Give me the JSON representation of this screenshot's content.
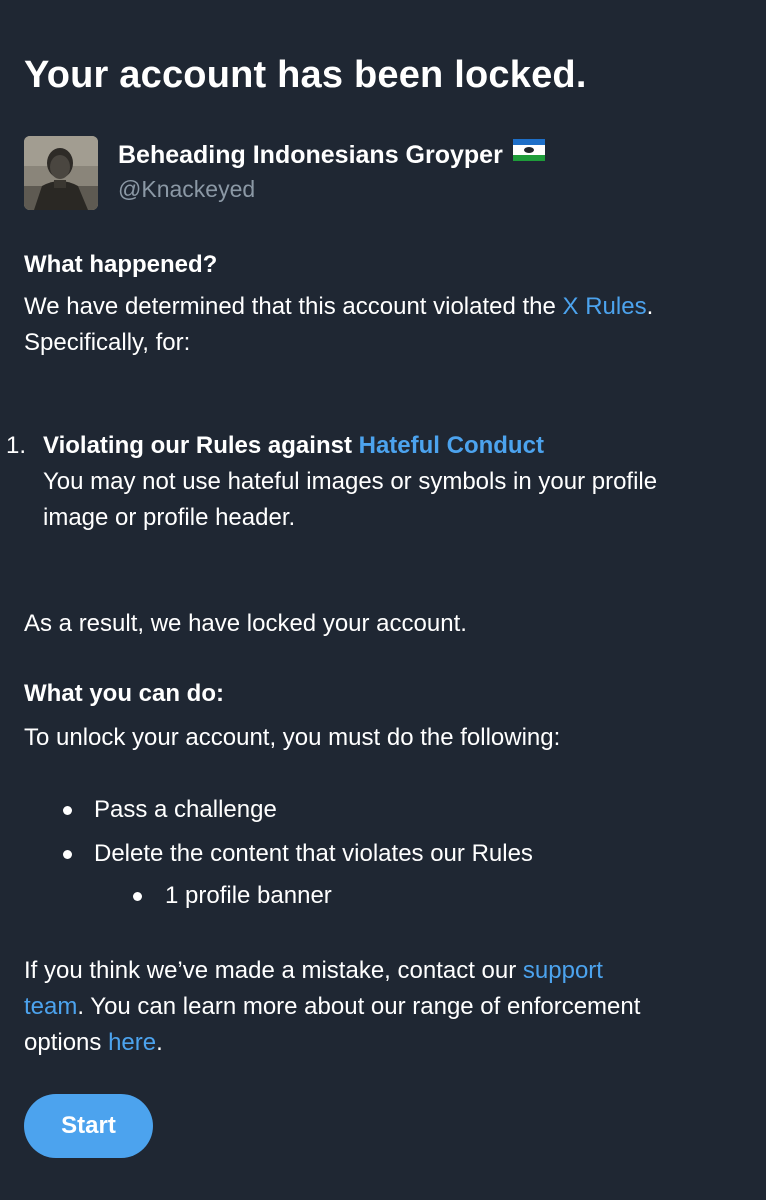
{
  "header": {
    "title": "Your account has been locked."
  },
  "account": {
    "display_name": "Beheading Indonesians Groyper",
    "flag_icon": "flag-emoji-icon",
    "handle": "@Knackeyed"
  },
  "what_happened": {
    "heading": "What happened?",
    "text_before_link": "We have determined that this account violated the ",
    "rules_link": "X Rules",
    "text_after_link": ".",
    "line2": "Specifically, for:"
  },
  "violations": [
    {
      "number": "1.",
      "title_prefix": "Violating our Rules against ",
      "title_link": "Hateful Conduct",
      "description": "You may not use hateful images or symbols in your profile image or profile header."
    }
  ],
  "result": {
    "text": "As a result, we have locked your account."
  },
  "what_you_can_do": {
    "heading": "What you can do:",
    "intro": "To unlock your account, you must do the following:",
    "steps": [
      "Pass a challenge",
      "Delete the content that violates our Rules"
    ],
    "sub_items": [
      "1 profile banner"
    ]
  },
  "mistake": {
    "line1_text": "If you think we’ve made a mistake, contact our ",
    "line1_link": "support",
    "line2_link": "team",
    "line2_text": ". You can learn more about our range of enforcement",
    "line3_text": "options ",
    "line3_link": "here",
    "line3_end": "."
  },
  "actions": {
    "start_label": "Start"
  },
  "colors": {
    "background": "#1f2733",
    "link": "#4ca3ee",
    "secondary_text": "#8b98a5",
    "button": "#4ca3ee"
  }
}
